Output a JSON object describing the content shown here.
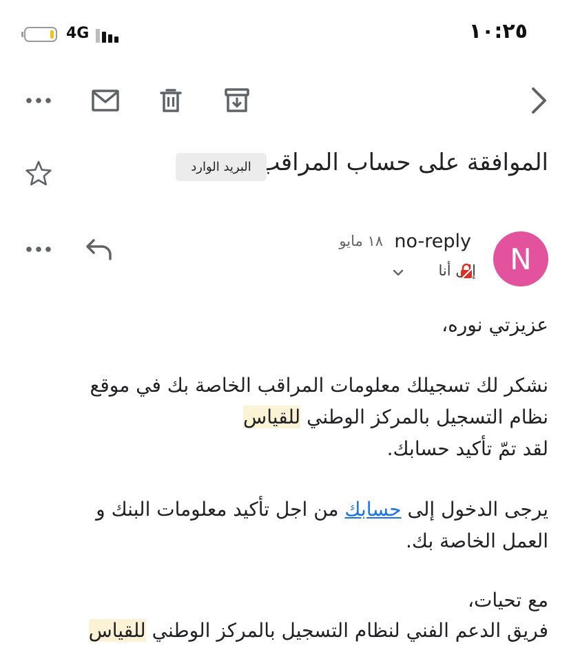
{
  "status_bar": {
    "time": "١٠:٢٥",
    "network": "4G"
  },
  "toolbar": {
    "back_icon": "chevron-right-icon",
    "archive_icon": "archive-icon",
    "delete_icon": "trash-icon",
    "mark_unread_icon": "mail-icon",
    "more_icon": "more-horizontal-icon"
  },
  "email": {
    "subject": "الموافقة على حساب المراقب",
    "label": "البريد الوارد",
    "sender_initial": "N",
    "sender_name": "no-reply",
    "date": "١٨ مايو",
    "recipient": "إلى أنا",
    "avatar_color": "#e2529d",
    "body": {
      "greeting": "عزيزتي نوره،",
      "p1_line1": "نشكر لك تسجيلك معلومات المراقب الخاصة بك في موقع",
      "p1_line2_prefix": "نظام التسجيل بالمركز الوطني ",
      "p1_line2_highlight": "للقياس",
      "p1_line3": "لقد تمّ تأكيد حسابك.",
      "p2_prefix": "يرجى الدخول إلى ",
      "p2_link": "حسابك",
      "p2_suffix": " من اجل تأكيد معلومات البنك و",
      "p2_line2": "العمل الخاصة بك.",
      "closing": "مع تحيات،",
      "signature_prefix": "فريق الدعم الفني لنظام التسجيل بالمركز الوطني ",
      "signature_highlight": "للقياس"
    }
  }
}
